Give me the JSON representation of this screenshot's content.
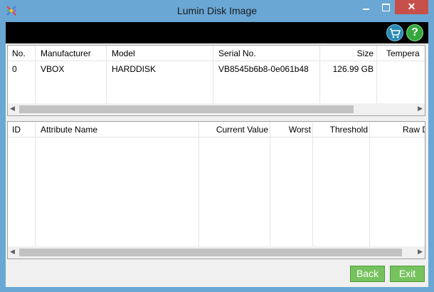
{
  "window": {
    "title": "Lumin Disk Image",
    "close_glyph": "✕"
  },
  "toolbar": {
    "cart_icon": "cart-icon",
    "help_label": "?"
  },
  "disks_table": {
    "columns": [
      "No.",
      "Manufacturer",
      "Model",
      "Serial No.",
      "Size",
      "Tempera"
    ],
    "rows": [
      [
        "0",
        "VBOX",
        "HARDDISK",
        "VB8545b6b8-0e061b48",
        "126.99 GB",
        ""
      ]
    ]
  },
  "attributes_table": {
    "columns": [
      "ID",
      "Attribute Name",
      "Current Value",
      "Worst",
      "Threshold",
      "Raw Da"
    ]
  },
  "buttons": {
    "back": "Back",
    "exit": "Exit"
  },
  "colors": {
    "titlebar": "#6aa7d5",
    "close": "#c74f4a",
    "button": "#76c35e",
    "topbar": "#000000"
  }
}
